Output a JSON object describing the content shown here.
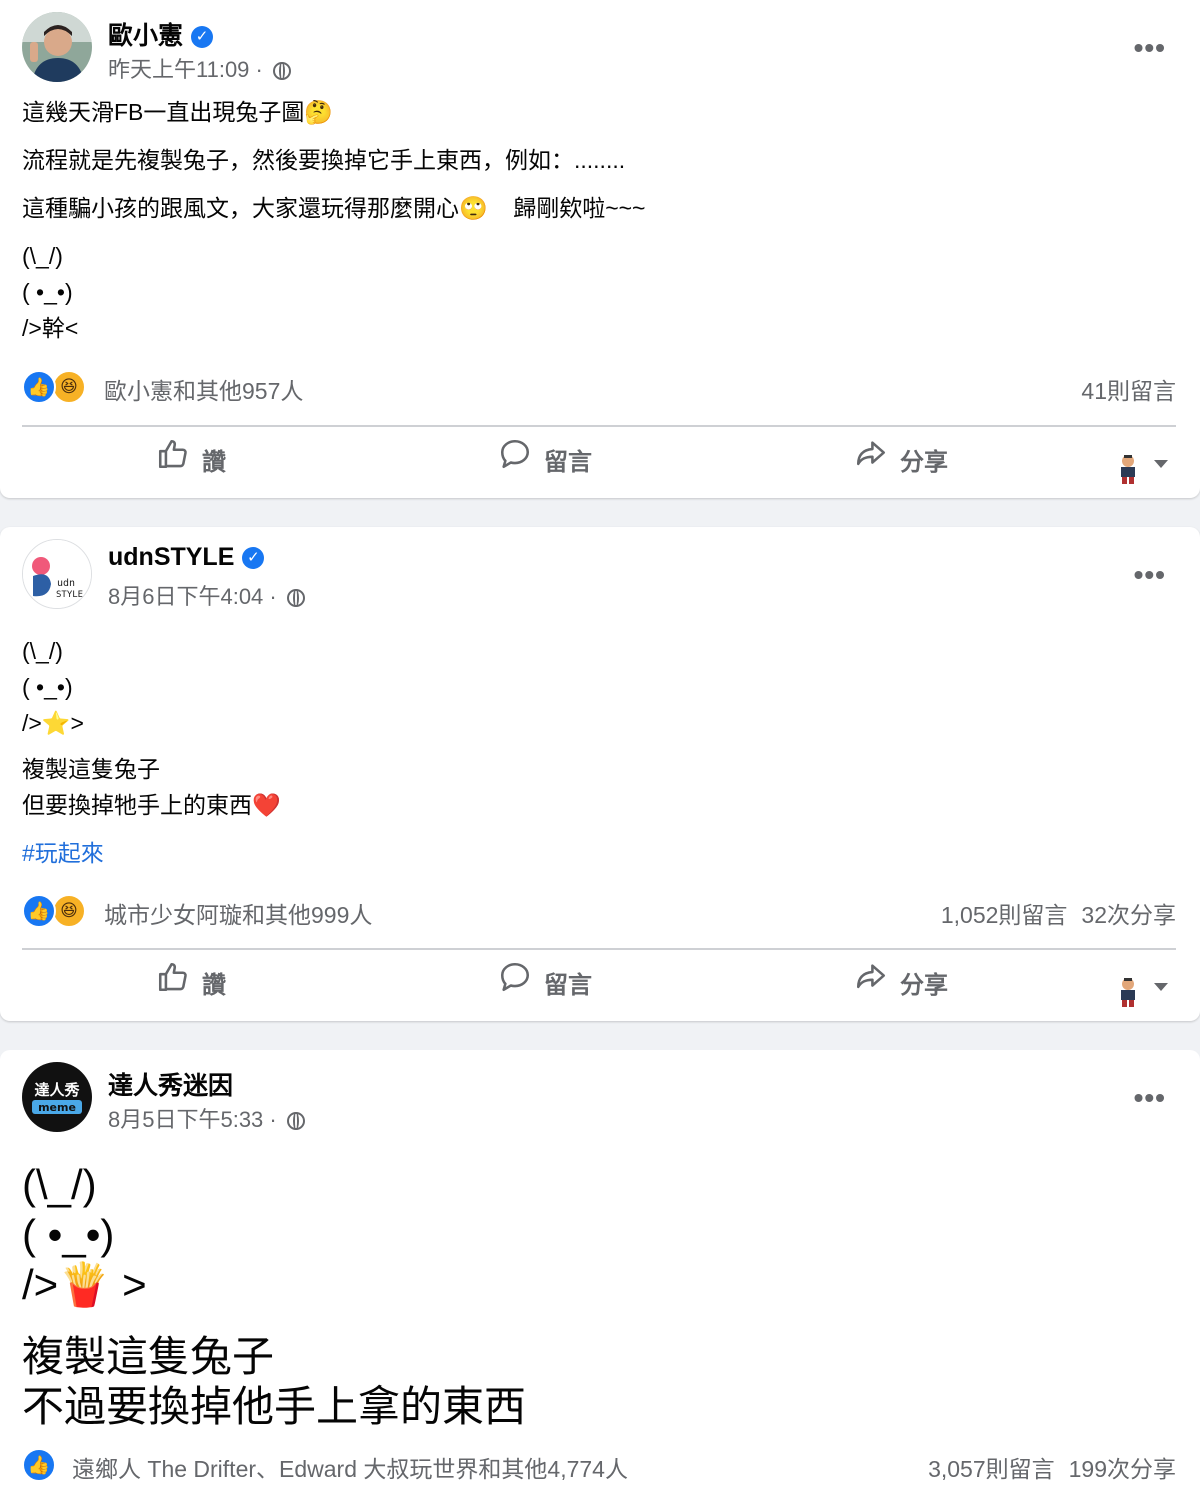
{
  "posts": [
    {
      "author": "歐小憲",
      "time": "昨天上午11:09 ·",
      "more": "•••",
      "lines": [
        "這幾天滑FB一直出現兔子圖🤔",
        "流程就是先複製兔子，然後要換掉它手上東西，例如：........",
        "這種騙小孩的跟風文，大家還玩得那麼開心🙄    歸剛欸啦~~~",
        "(\\_/)",
        "( •_•)",
        "/>幹<"
      ],
      "reactions_text": "歐小憲和其他957人",
      "comments": "41則留言",
      "shares": "",
      "actions": {
        "like": "讚",
        "comment": "留言",
        "share": "分享"
      }
    },
    {
      "author": "udnSTYLE",
      "time": "8月6日下午4:04 ·",
      "more": "•••",
      "lines": [
        "(\\_/)",
        "( •_•)",
        "/>⭐>",
        "複製這隻兔子",
        "但要換掉牠手上的東西❤️"
      ],
      "hashtag": "#玩起來",
      "reactions_text": "城市少女阿璇和其他999人",
      "comments": "1,052則留言",
      "shares": "32次分享",
      "actions": {
        "like": "讚",
        "comment": "留言",
        "share": "分享"
      }
    },
    {
      "author": "達人秀迷因",
      "time": "8月5日下午5:33 ·",
      "more": "•••",
      "lines": [
        "(\\_/)",
        "( •_•)",
        "/>🍟 >",
        "複製這隻兔子",
        "不過要換掉他手上拿的東西"
      ],
      "reactions_text": "遠鄉人 The Drifter、Edward 大叔玩世界和其他4,774人",
      "comments": "3,057則留言",
      "shares": "199次分享"
    }
  ],
  "avatars": {
    "udn_line1": "udn",
    "udn_line2": "STYLE",
    "meme_line1": "達人秀",
    "meme_line2": "meme"
  },
  "icons": {
    "like_reaction": "👍",
    "haha_reaction": "😆",
    "verified": "✓"
  },
  "colors": {
    "facebook_blue": "#1877f2",
    "secondary_text": "#65676b",
    "hashtag": "#216fdb"
  }
}
